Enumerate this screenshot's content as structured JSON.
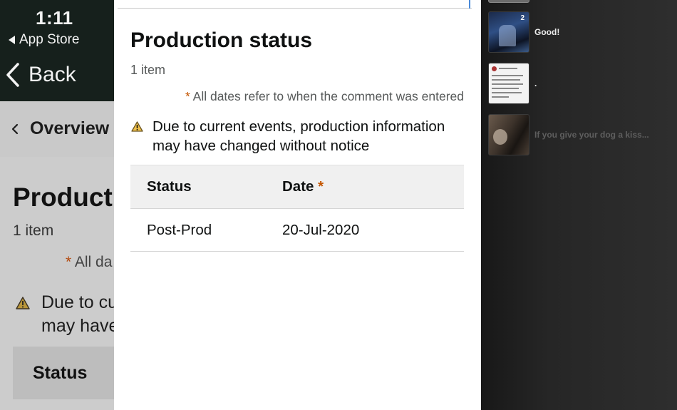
{
  "background_app": {
    "status_time": "1:11",
    "app_store_label": "App Store",
    "back_label": "Back",
    "overview_label": "Overview",
    "title": "Producti",
    "item_count": "1 item",
    "dates_note_prefix": "* ",
    "dates_note": "All da",
    "warning_line1": "Due to cu",
    "warning_line2": "may have",
    "status_header": "Status"
  },
  "sheet": {
    "title": "Production status",
    "item_count": "1 item",
    "dates_note_asterisk": "*",
    "dates_note": "All dates refer to when the comment was entered",
    "warning": "Due to current events, production information may have changed without notice",
    "warning_icon": "warning-triangle-icon",
    "table": {
      "headers": {
        "status": "Status",
        "date": "Date",
        "date_asterisk": "*"
      },
      "rows": [
        {
          "status": "Post-Prod",
          "date": "20-Jul-2020"
        }
      ]
    }
  },
  "right_pane": {
    "items": [
      {
        "label": "Good!",
        "badge": "2"
      },
      {
        "label": "."
      },
      {
        "label": "If you give your dog a kiss..."
      }
    ]
  },
  "colors": {
    "accent_asterisk": "#c45500",
    "warning_icon": "#f0c14b",
    "top_bar": "#16201c"
  }
}
